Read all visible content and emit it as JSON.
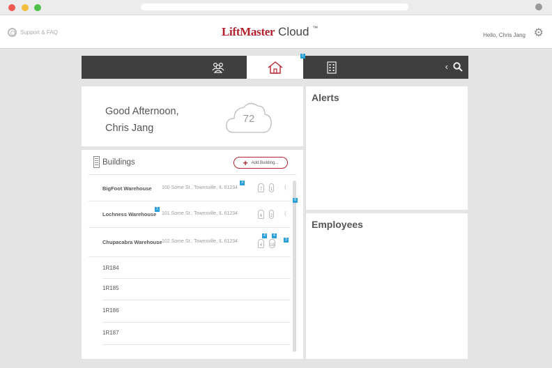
{
  "header": {
    "support_label": "Support & FAQ",
    "logo_brand": "LiftMaster",
    "logo_product": "Cloud",
    "logo_tm": "™",
    "greeting_user": "Hello, Chris Jang"
  },
  "nav": {
    "tabs": [
      {
        "name": "people",
        "icon": "people-icon"
      },
      {
        "name": "home",
        "icon": "home-icon",
        "active": true
      },
      {
        "name": "buildings",
        "icon": "building-icon"
      }
    ],
    "home_badge": "1",
    "back_glyph": "‹"
  },
  "welcome": {
    "line1": "Good Afternoon,",
    "line2": "Chris Jang",
    "temperature": "72"
  },
  "buildings": {
    "title": "Buildings",
    "add_button": "Add Building...",
    "rows": [
      {
        "name": "BigFoot Warehouse",
        "address": "100 Some St., Townsville, IL 61234",
        "badge": "3",
        "lock_count": "7",
        "key_count": "1"
      },
      {
        "name": "Lochness Warehouse",
        "address": "101 Some St., Townsville, IL 61234",
        "badge": "1",
        "lock_count": "6",
        "key_count": "2"
      },
      {
        "name": "Chupacabra Warehouse",
        "address": "102 Some St., Townsville, IL 61234",
        "badge": "3",
        "lock_count": "4",
        "key_count": "16",
        "lock_badge": "4",
        "key_badge": "4"
      }
    ],
    "sub_items": [
      "1R184",
      "1R185",
      "1R186",
      "1R187"
    ],
    "side_badges": [
      "6",
      "3"
    ]
  },
  "alerts": {
    "title": "Alerts"
  },
  "employees": {
    "title": "Employees"
  },
  "colors": {
    "brand_red": "#b3212e",
    "nav_dark": "#3f3f3f",
    "badge_blue": "#2a9fd8"
  }
}
